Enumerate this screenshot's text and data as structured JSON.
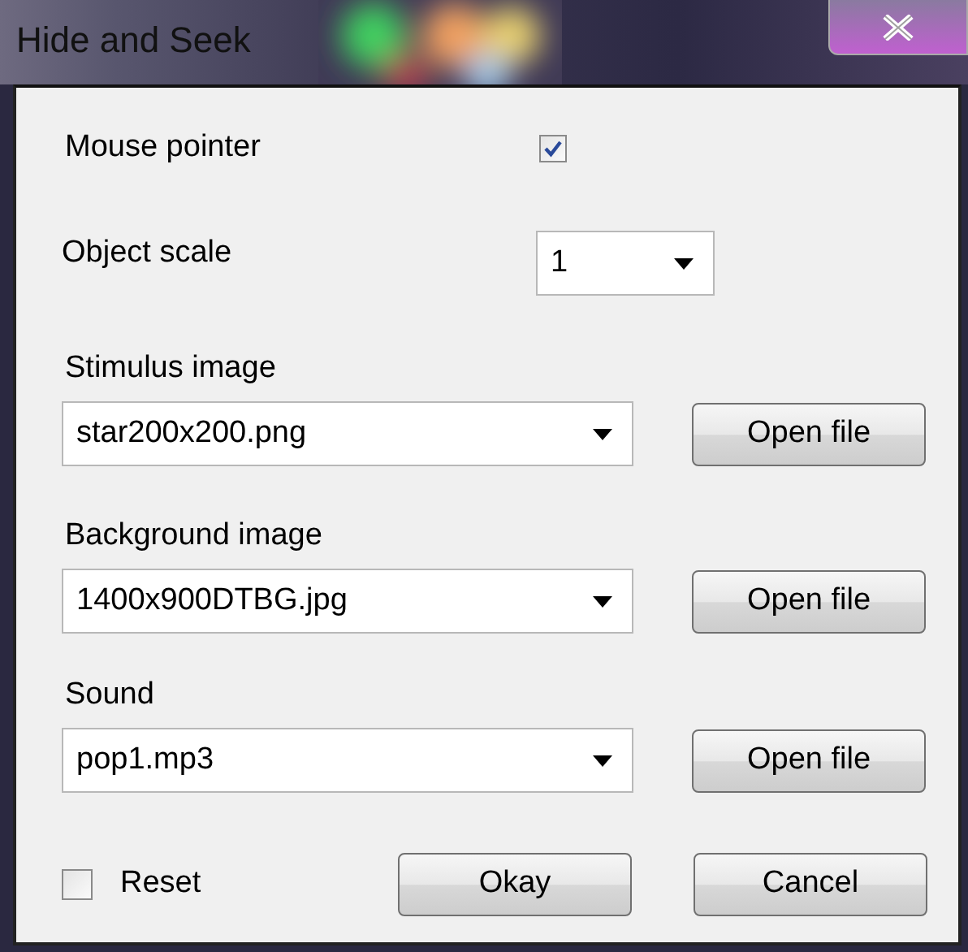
{
  "window": {
    "title": "Hide and Seek"
  },
  "fields": [
    {
      "kind": "checkbox",
      "label": "Mouse pointer",
      "checked": true
    },
    {
      "kind": "dropdown",
      "label": "Object scale",
      "value": "1"
    },
    {
      "kind": "file",
      "label": "Stimulus image",
      "value": "star200x200.png",
      "button": "Open file"
    },
    {
      "kind": "file",
      "label": "Background image",
      "value": "1400x900DTBG.jpg",
      "button": "Open file"
    },
    {
      "kind": "file",
      "label": "Sound",
      "value": "pop1.mp3",
      "button": "Open file"
    }
  ],
  "reset": {
    "label": "Reset",
    "checked": false
  },
  "buttons": [
    "Okay",
    "Cancel"
  ]
}
